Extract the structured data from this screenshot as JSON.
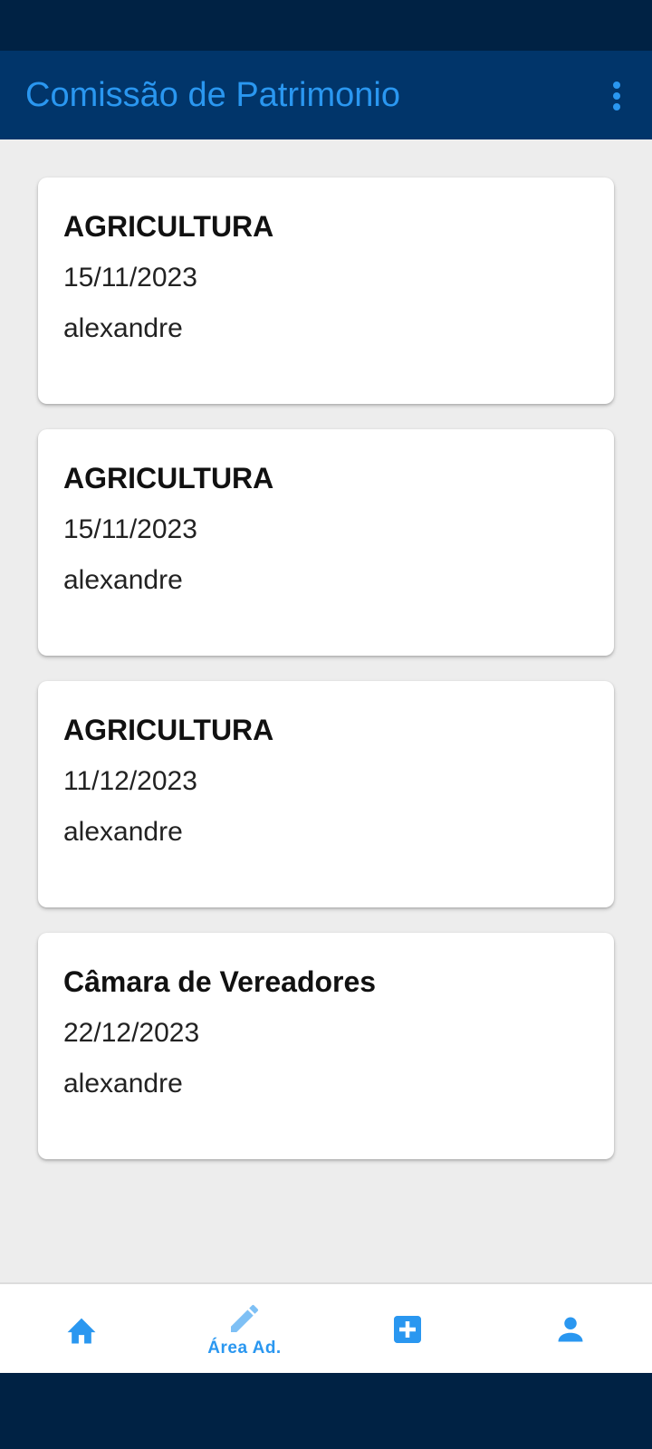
{
  "app": {
    "title": "Comissão de Patrimonio",
    "accent_color": "#2a97f0",
    "header_color": "#01356a",
    "menu_icon": "more-vert-icon"
  },
  "cards": [
    {
      "title": "AGRICULTURA",
      "date": "15/11/2023",
      "user": "alexandre"
    },
    {
      "title": "AGRICULTURA",
      "date": "15/11/2023",
      "user": "alexandre"
    },
    {
      "title": "AGRICULTURA",
      "date": "11/12/2023",
      "user": "alexandre"
    },
    {
      "title": "Câmara de Vereadores",
      "date": "22/12/2023",
      "user": "alexandre"
    }
  ],
  "bottom_nav": {
    "items": [
      {
        "icon": "home-icon",
        "label": ""
      },
      {
        "icon": "pencil-icon",
        "label": "Área Ad."
      },
      {
        "icon": "add-box-icon",
        "label": ""
      },
      {
        "icon": "person-icon",
        "label": ""
      }
    ]
  }
}
